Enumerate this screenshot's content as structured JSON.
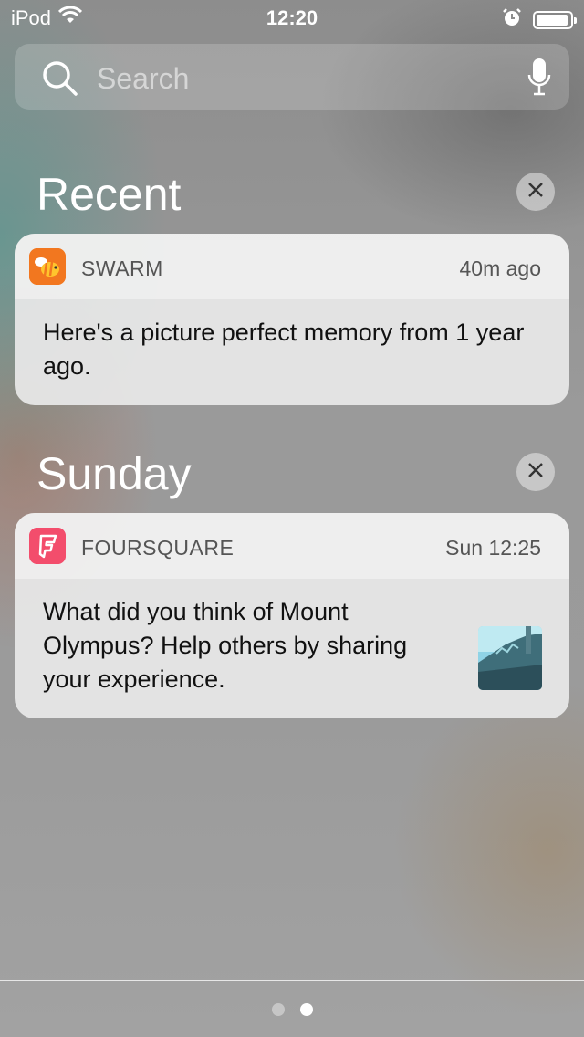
{
  "status_bar": {
    "carrier": "iPod",
    "time": "12:20",
    "battery_level": 0.95
  },
  "search": {
    "placeholder": "Search"
  },
  "sections": [
    {
      "title": "Recent",
      "notifications": [
        {
          "app": "SWARM",
          "app_icon": "swarm-bee-icon",
          "time": "40m ago",
          "message": "Here's a picture perfect memory from 1 year ago."
        }
      ]
    },
    {
      "title": "Sunday",
      "notifications": [
        {
          "app": "FOURSQUARE",
          "app_icon": "foursquare-icon",
          "time": "Sun 12:25",
          "message": "What did you think of Mount Olympus? Help others by sharing your experience.",
          "thumbnail": "photo-thumbnail"
        }
      ]
    }
  ],
  "page_indicator": {
    "count": 2,
    "active": 2
  },
  "colors": {
    "swarm": "#f2771f",
    "foursquare": "#f34d6c",
    "text_light": "#ffffff"
  }
}
